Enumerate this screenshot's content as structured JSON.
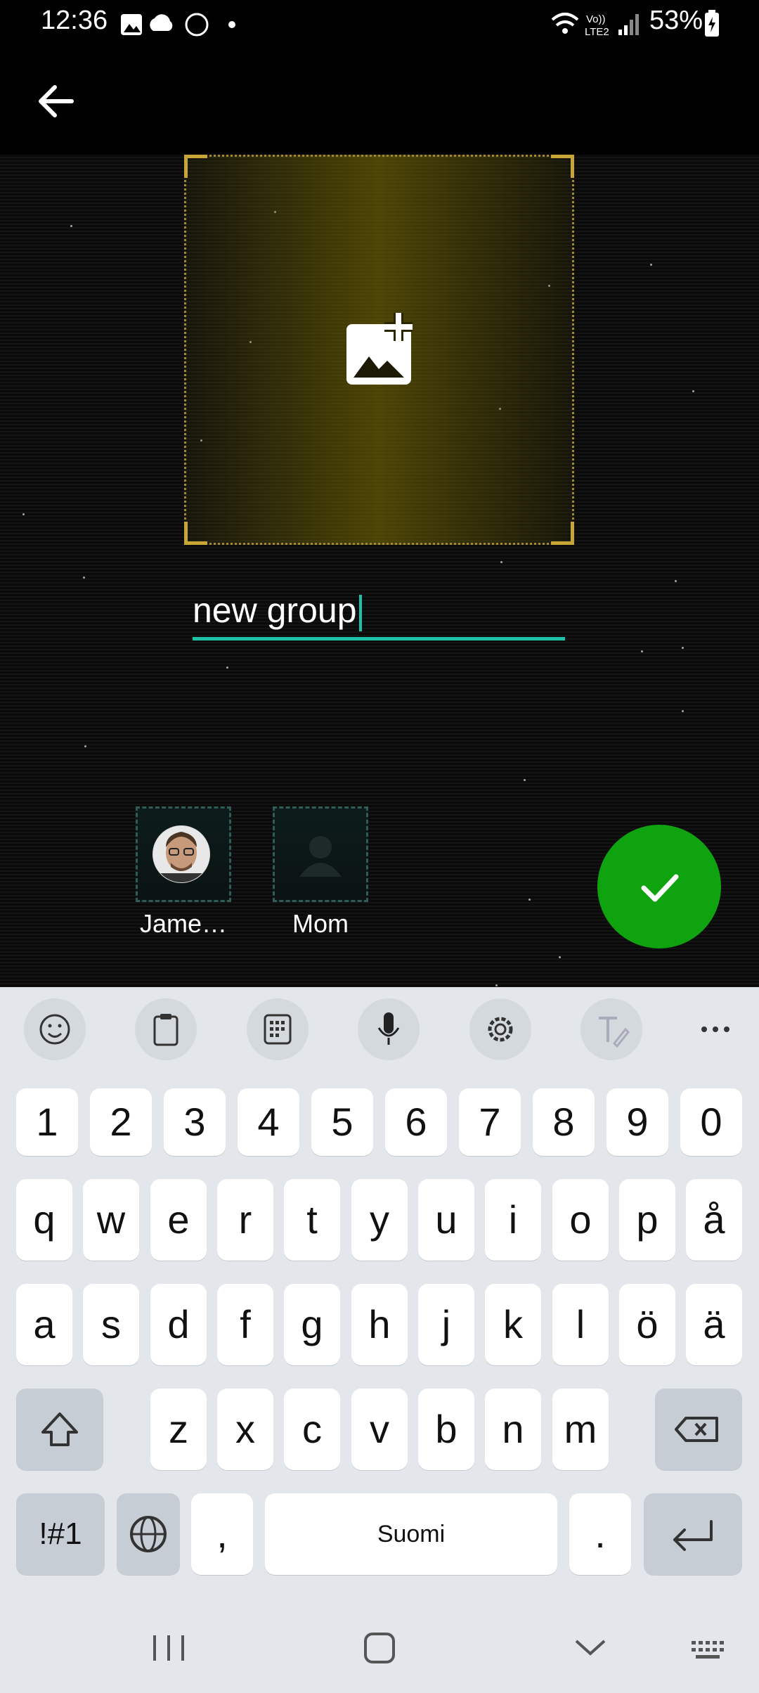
{
  "status_bar": {
    "time": "12:36",
    "battery": "53%",
    "network": "LTE2"
  },
  "header": {
    "back_icon": "arrow-left-icon"
  },
  "group_photo": {
    "icon": "add-photo-icon"
  },
  "group_name": {
    "value": "new group"
  },
  "members": [
    {
      "name": "Jame…",
      "avatar": "photo"
    },
    {
      "name": "Mom",
      "avatar": "placeholder"
    }
  ],
  "confirm_icon": "check-icon",
  "keyboard": {
    "toolbar": [
      "emoji-icon",
      "clipboard-icon",
      "keypad-icon",
      "mic-icon",
      "settings-icon",
      "handwriting-icon",
      "more-icon"
    ],
    "row_numbers": [
      "1",
      "2",
      "3",
      "4",
      "5",
      "6",
      "7",
      "8",
      "9",
      "0"
    ],
    "row1": [
      "q",
      "w",
      "e",
      "r",
      "t",
      "y",
      "u",
      "i",
      "o",
      "p",
      "å"
    ],
    "row2": [
      "a",
      "s",
      "d",
      "f",
      "g",
      "h",
      "j",
      "k",
      "l",
      "ö",
      "ä"
    ],
    "row3": [
      "z",
      "x",
      "c",
      "v",
      "b",
      "n",
      "m"
    ],
    "symbols_key": "!#1",
    "comma_key": ",",
    "space_label": "Suomi",
    "period_key": "."
  },
  "colors": {
    "accent": "#1fc2a8",
    "confirm": "#0fa30f",
    "frame": "#c8a635"
  }
}
